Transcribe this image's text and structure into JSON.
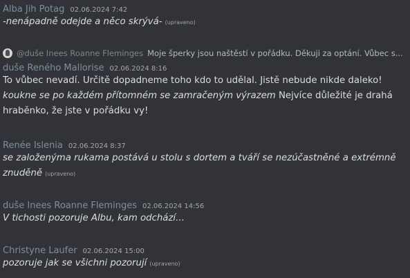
{
  "messages": [
    {
      "author": "Alba Jih Potag",
      "timestamp": "02.06.2024 7:42",
      "text_italic": "-nenápadně odejde a něco skrývá-",
      "edited": "(upraveno)"
    },
    {
      "reply": {
        "mention": "@duše Inees Roanne Fleminges",
        "text": "Moje šperky jsou naštěstí v pořádku. Děkuji za optání. Vůbec s..."
      },
      "author": "duše Reného Mallorise",
      "timestamp": "02.06.2024 8:16",
      "line1": "To vůbec nevadí. Určitě dopadneme toho kdo to udělal. Jistě nebude nikde daleko!",
      "line2_italic": "koukne se po každém přítomném se zamračeným výrazem",
      "line2_rest": " Nejvíce důležité je drahá",
      "line3": "hraběnko, že jste v pořádku vy!"
    },
    {
      "author": "Renée Islenia",
      "timestamp": "02.06.2024 8:37",
      "line1_italic": "se založenýma rukama postává u stolu s dortem a tváří se nezúčastněné a extrémně",
      "line2_italic": "znuděně",
      "edited": "(upraveno)"
    },
    {
      "author": "duše Inees Roanne Fleminges",
      "timestamp": "02.06.2024 14:56",
      "text_italic": "V tichosti pozoruje Albu, kam odchází..."
    },
    {
      "author": "Christyne Laufer",
      "timestamp": "02.06.2024 15:00",
      "text_italic": "pozoruje jak se všichni pozorují",
      "edited": "(upraveno)"
    }
  ]
}
